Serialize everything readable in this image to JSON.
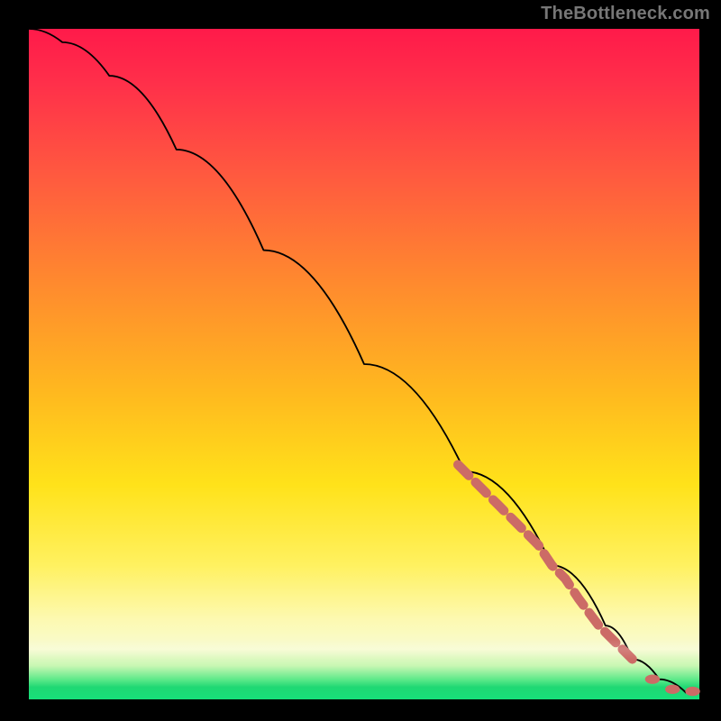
{
  "watermark": "TheBottleneck.com",
  "chart_data": {
    "type": "line",
    "title": "",
    "xlabel": "",
    "ylabel": "",
    "xlim": [
      0,
      100
    ],
    "ylim": [
      0,
      100
    ],
    "grid": false,
    "legend": false,
    "background_gradient": {
      "orientation": "vertical",
      "stops": [
        {
          "pos": 0.0,
          "color": "#ff1a4a"
        },
        {
          "pos": 0.22,
          "color": "#ff5a3f"
        },
        {
          "pos": 0.54,
          "color": "#ffb81f"
        },
        {
          "pos": 0.8,
          "color": "#fff160"
        },
        {
          "pos": 0.92,
          "color": "#f7fbd0"
        },
        {
          "pos": 0.97,
          "color": "#5fe98a"
        },
        {
          "pos": 1.0,
          "color": "#17e07a"
        }
      ]
    },
    "series": [
      {
        "name": "curve",
        "color": "#000000",
        "x": [
          0,
          5,
          12,
          22,
          35,
          50,
          65,
          78,
          86,
          90,
          94,
          98,
          100
        ],
        "values": [
          100,
          98,
          93,
          82,
          67,
          50,
          34,
          20,
          11,
          6,
          3,
          1,
          1
        ]
      }
    ],
    "markers": {
      "name": "highlight-segment",
      "color": "#cc6b66",
      "style": "thick-dashed",
      "x": [
        64,
        66,
        68,
        70,
        72,
        74,
        76,
        78,
        80,
        82,
        85,
        88,
        90,
        93,
        96,
        99
      ],
      "values": [
        35,
        33,
        31,
        29,
        27,
        25,
        23,
        20,
        18,
        15,
        11,
        8,
        6,
        3,
        1.5,
        1.2
      ]
    }
  }
}
